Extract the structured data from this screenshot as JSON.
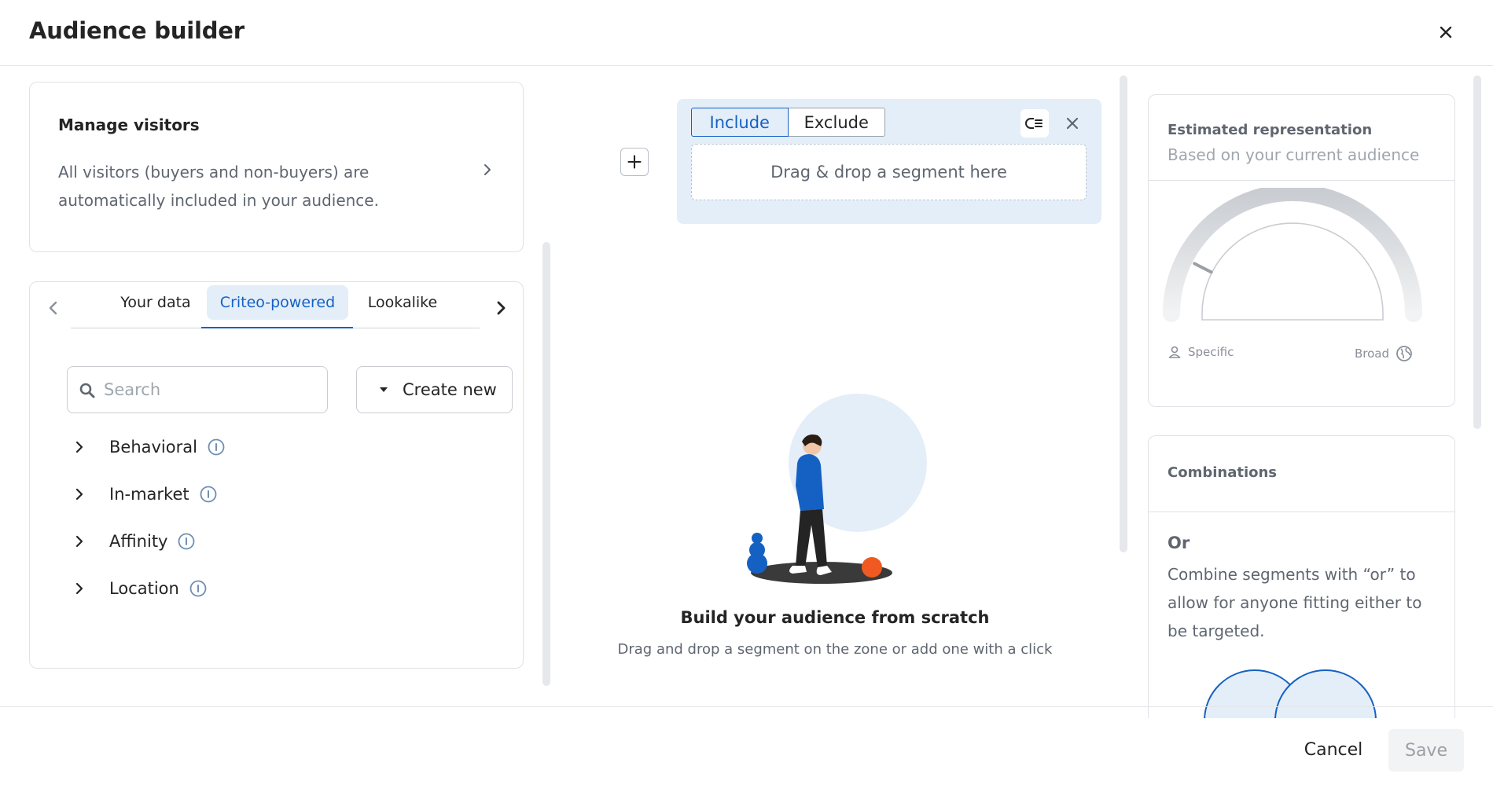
{
  "header": {
    "title": "Audience builder"
  },
  "footer": {
    "cancel_label": "Cancel",
    "save_label": "Save"
  },
  "manage": {
    "title": "Manage visitors",
    "description": "All visitors (buyers and non-buyers) are automatically included in your audience."
  },
  "segments": {
    "tabs": [
      {
        "label": "Your data",
        "active": false
      },
      {
        "label": "Criteo-powered",
        "active": true
      },
      {
        "label": "Lookalike",
        "active": false
      }
    ],
    "search_placeholder": "Search",
    "create_label": "Create new",
    "categories": [
      {
        "label": "Behavioral"
      },
      {
        "label": "In-market"
      },
      {
        "label": "Affinity"
      },
      {
        "label": "Location"
      }
    ]
  },
  "builder": {
    "include_label": "Include",
    "exclude_label": "Exclude",
    "selected_mode": "Include",
    "drop_text": "Drag & drop a segment here",
    "empty_title": "Build your audience from scratch",
    "empty_subtitle": "Drag and drop a segment on the zone or add one with a click"
  },
  "estimate": {
    "title": "Estimated representation",
    "subtitle": "Based on your current audience",
    "specific_label": "Specific",
    "broad_label": "Broad",
    "gauge_level": 0.15
  },
  "combinations": {
    "title": "Combinations",
    "or_title": "Or",
    "or_description": "Combine segments with “or” to allow for anyone fitting either to be targeted."
  },
  "colors": {
    "accent": "#1561c3",
    "accent_bg": "#e4eef9",
    "text": "#242424",
    "muted": "#5f6670",
    "illustration_orange": "#f05a22"
  }
}
